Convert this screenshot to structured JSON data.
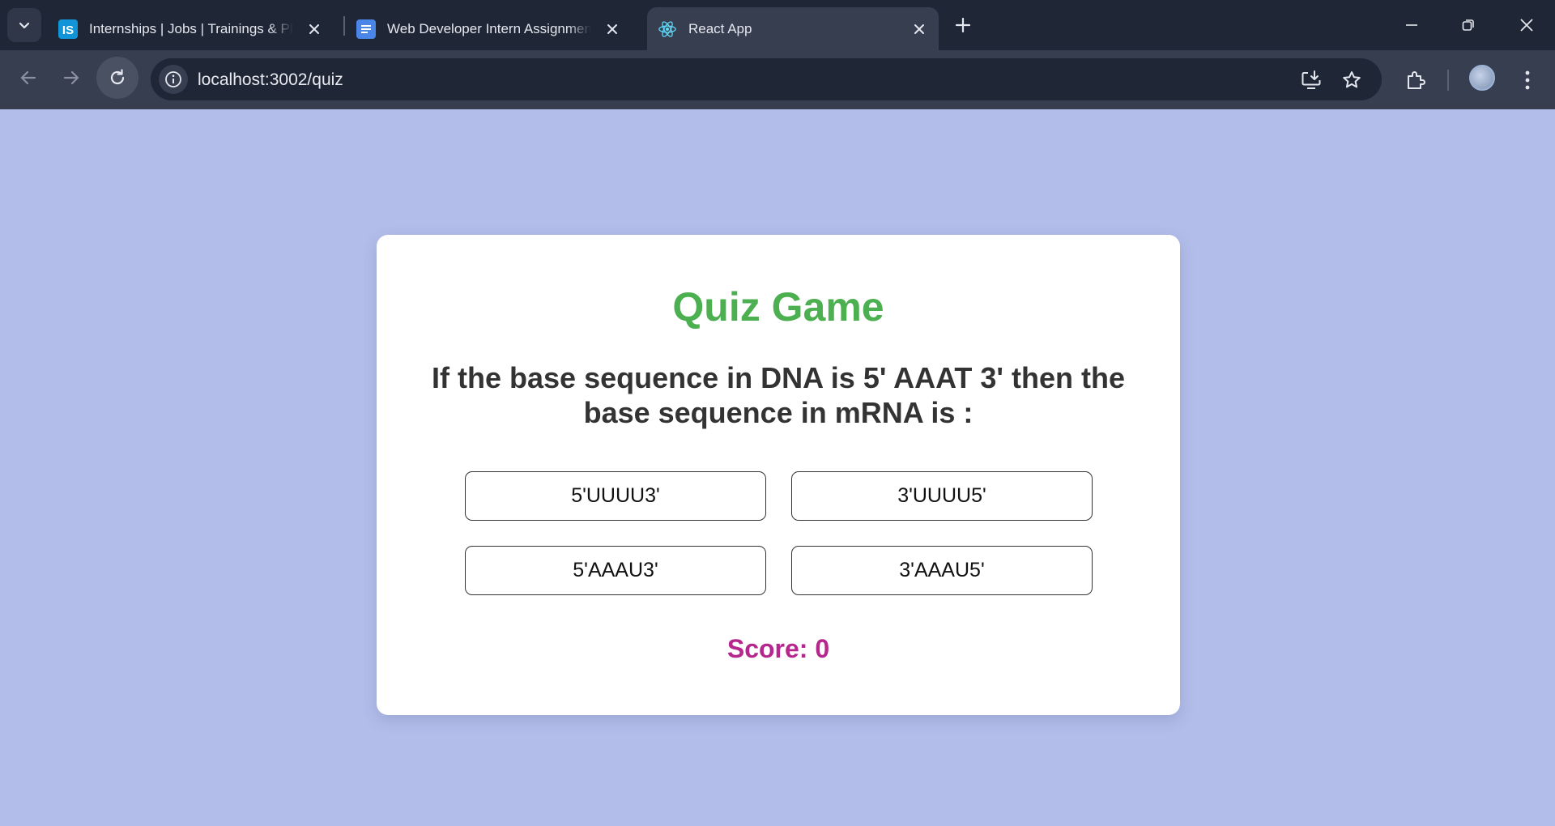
{
  "browser": {
    "tabs": [
      {
        "title": "Internships | Jobs | Trainings & Placements",
        "favicon": "IS",
        "active": false
      },
      {
        "title": "Web Developer Intern Assignment",
        "favicon": "docs-icon",
        "active": false
      },
      {
        "title": "React App",
        "favicon": "react-icon",
        "active": true
      }
    ],
    "url": "localhost:3002/quiz",
    "colors": {
      "tabbar": "#1f2636",
      "toolbar": "#363e50",
      "page_bg": "#b2bde9"
    }
  },
  "quiz": {
    "title": "Quiz Game",
    "question": "If the base sequence in DNA is 5' AAAT 3' then the base sequence in mRNA is :",
    "options": [
      "5'UUUU3'",
      "3'UUUU5'",
      "5'AAAU3'",
      "3'AAAU5'"
    ],
    "score_label": "Score:",
    "score": "0",
    "colors": {
      "title": "#4caf50",
      "question": "#333333",
      "score": "#b5278c"
    }
  }
}
